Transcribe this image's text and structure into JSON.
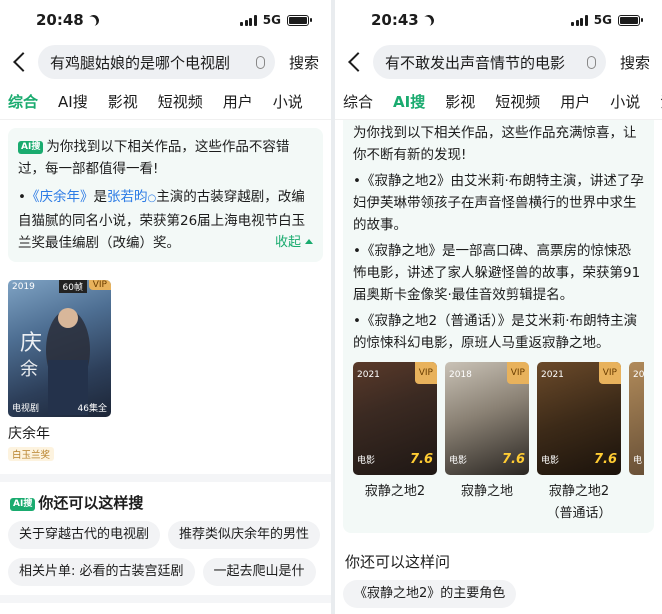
{
  "left": {
    "status": {
      "time": "20:48",
      "network": "5G"
    },
    "search": {
      "query": "有鸡腿姑娘的是哪个电视剧",
      "button": "搜索"
    },
    "tabs": [
      "综合",
      "AI搜",
      "影视",
      "短视频",
      "用户",
      "小说"
    ],
    "active_tab": "综合",
    "ai": {
      "badge": "AI搜",
      "intro": "为你找到以下相关作品，这些作品不容错过，每一部都值得一看!",
      "bullet_title": "《庆余年》",
      "bullet_mid": "是",
      "bullet_person": "张若昀",
      "bullet_rest": "主演的古装穿越剧，改编自猫腻的同名小说，荣获第26届上海电视节白玉兰奖最佳编剧（改编）奖。",
      "collapse": "收起"
    },
    "poster": {
      "year": "2019",
      "frames": "60帧",
      "vip": "VIP",
      "category": "电视剧",
      "episodes": "46集全",
      "title": "庆余年",
      "tag": "白玉兰奖"
    },
    "also": {
      "badge": "AI搜",
      "title": "你还可以这样搜",
      "chips_row1": [
        "关于穿越古代的电视剧",
        "推荐类似庆余年的男性"
      ],
      "chips_row2": [
        "相关片单: 必看的古装宫廷剧",
        "一起去爬山是什"
      ]
    }
  },
  "right": {
    "status": {
      "time": "20:43",
      "network": "5G"
    },
    "search": {
      "query": "有不敢发出声音情节的电影",
      "button": "搜索"
    },
    "tabs": [
      "综合",
      "AI搜",
      "影视",
      "短视频",
      "用户",
      "小说",
      "泊"
    ],
    "active_tab": "AI搜",
    "ai": {
      "intro": "为你找到以下相关作品，这些作品充满惊喜，让你不断有新的发现!",
      "bullets": [
        "•《寂静之地2》由艾米莉·布朗特主演，讲述了孕妇伊芙琳带领孩子在声音怪兽横行的世界中求生的故事。",
        "•《寂静之地》是一部高口碑、高票房的惊悚恐怖电影，讲述了家人躲避怪兽的故事，荣获第91届奥斯卡金像奖·最佳音效剪辑提名。",
        "•《寂静之地2（普通话）》是艾米莉·布朗特主演的惊悚科幻电影，原班人马重返寂静之地。"
      ]
    },
    "posters": [
      {
        "year": "2021",
        "vip": "VIP",
        "category": "电影",
        "score": "7.6",
        "title": "寂静之地2"
      },
      {
        "year": "2018",
        "vip": "VIP",
        "category": "电影",
        "score": "7.6",
        "title": "寂静之地"
      },
      {
        "year": "2021",
        "vip": "VIP",
        "category": "电影",
        "score": "7.6",
        "title": "寂静之地2（普通话）"
      },
      {
        "year": "20",
        "vip": "",
        "category": "电",
        "score": "",
        "title": "寂"
      }
    ],
    "also": {
      "title": "你还可以这样问",
      "chips": [
        "《寂静之地2》的主要角色"
      ]
    }
  }
}
